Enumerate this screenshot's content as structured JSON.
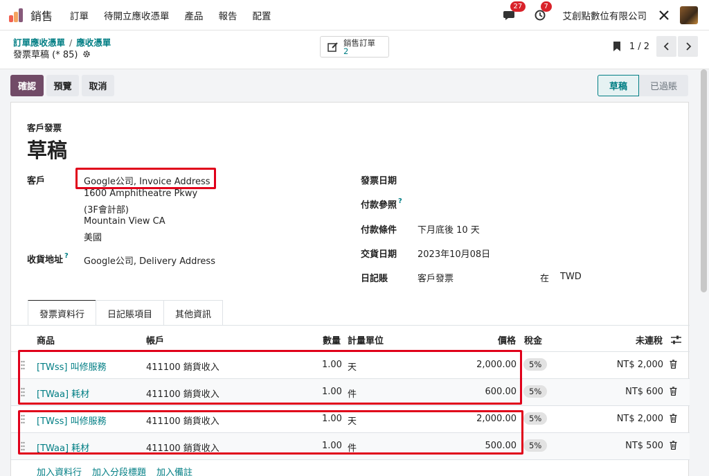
{
  "nav": {
    "brand": "銷售",
    "menu": [
      "訂單",
      "待開立應收憑單",
      "產品",
      "報告",
      "配置"
    ],
    "messages_count": "27",
    "activities_count": "7",
    "company": "艾創點數位有限公司"
  },
  "control": {
    "breadcrumb_1": "訂單應收憑單",
    "breadcrumb_sep": "/",
    "breadcrumb_2": "應收憑單",
    "record_title": "發票草稿 (* 85)",
    "smart_label": "銷售訂單",
    "smart_count": "2",
    "pager": "1 / 2"
  },
  "actions": {
    "confirm": "確認",
    "preview": "預覽",
    "cancel": "取消"
  },
  "status": {
    "draft": "草稿",
    "posted": "已過賬"
  },
  "form": {
    "type": "客戶發票",
    "title": "草稿",
    "customer_label": "客戶",
    "customer_name": "Google公司, Invoice Address",
    "address_1": "1600 Amphitheatre Pkwy",
    "address_2": "(3F會計部)",
    "address_3": "Mountain View CA",
    "address_4": "美國",
    "delivery_label": "收貨地址",
    "delivery_help": "?",
    "delivery_value": "Google公司, Delivery Address",
    "invoice_date_label": "發票日期",
    "payment_ref_label": "付款參照",
    "payment_ref_help": "?",
    "payment_terms_label": "付款條件",
    "payment_terms_value": "下月底後 10 天",
    "delivery_date_label": "交貨日期",
    "delivery_date_value": "2023年10月08日",
    "journal_label": "日記賬",
    "journal_value": "客戶發票",
    "journal_in": "在",
    "currency": "TWD"
  },
  "tabs": [
    "發票資料行",
    "日記賬項目",
    "其他資訊"
  ],
  "table": {
    "headers": {
      "product": "商品",
      "account": "帳戶",
      "qty": "數量",
      "uom": "計量單位",
      "price": "價格",
      "tax": "稅金",
      "subtotal": "未連稅"
    },
    "rows": [
      {
        "product": "[TWss] 叫修服務",
        "account": "411100 銷貨收入",
        "qty": "1.00",
        "uom": "天",
        "price": "2,000.00",
        "tax": "5%",
        "subtotal": "NT$ 2,000"
      },
      {
        "product": "[TWaa] 耗材",
        "account": "411100 銷貨收入",
        "qty": "1.00",
        "uom": "件",
        "price": "600.00",
        "tax": "5%",
        "subtotal": "NT$ 600"
      },
      {
        "product": "[TWss] 叫修服務",
        "account": "411100 銷貨收入",
        "qty": "1.00",
        "uom": "天",
        "price": "2,000.00",
        "tax": "5%",
        "subtotal": "NT$ 2,000"
      },
      {
        "product": "[TWaa] 耗材",
        "account": "411100 銷貨收入",
        "qty": "1.00",
        "uom": "件",
        "price": "500.00",
        "tax": "5%",
        "subtotal": "NT$ 500"
      }
    ],
    "add_line": "加入資料行",
    "add_section": "加入分段標題",
    "add_note": "加入備註"
  },
  "colors": {
    "primary": "#714b67",
    "link": "#017e84",
    "highlight": "#e0001a"
  }
}
